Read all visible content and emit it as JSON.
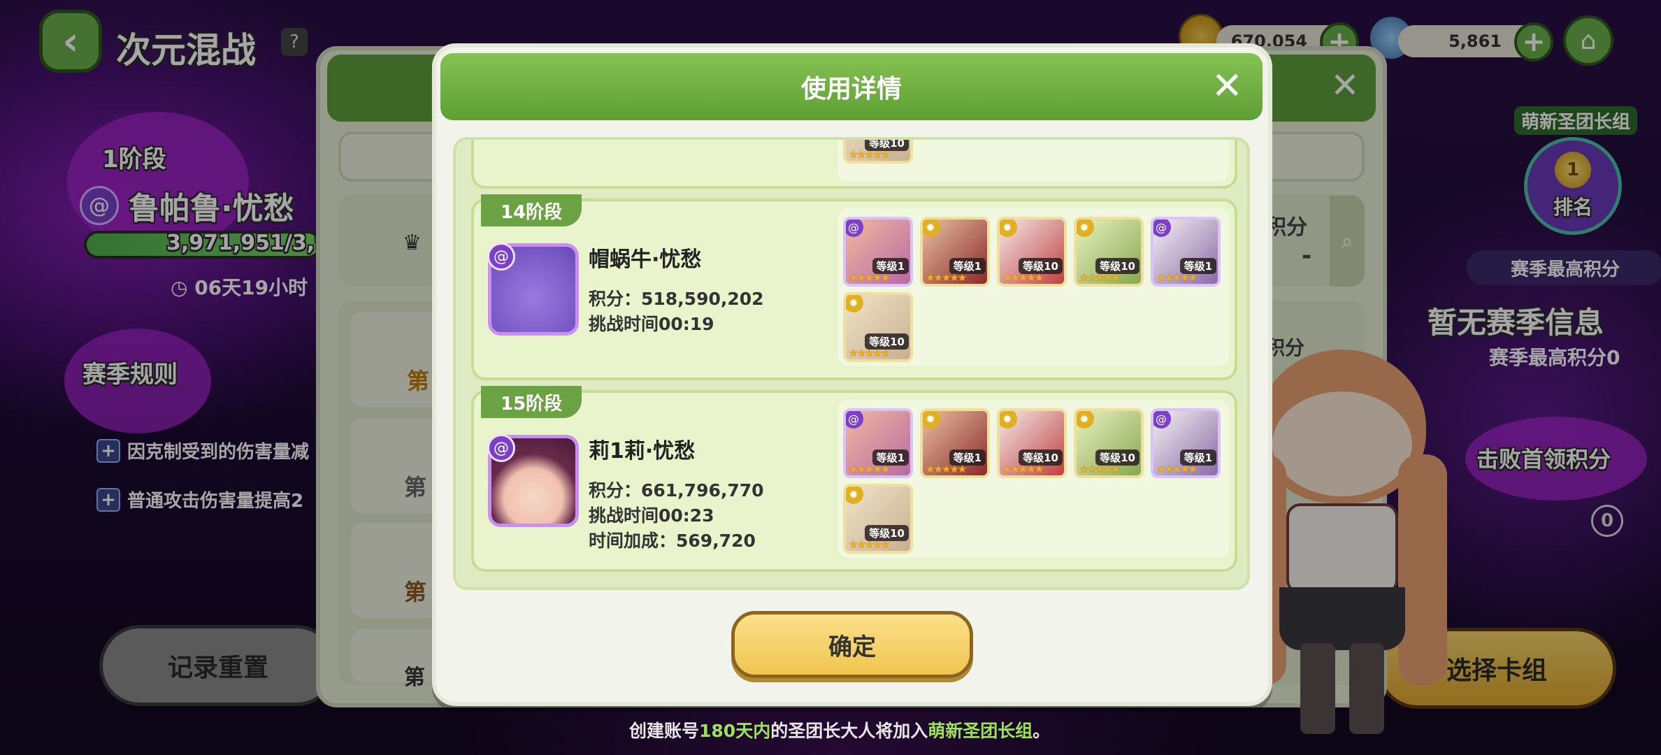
{
  "top_bar": {
    "title": "次元混战",
    "help_icon": "?",
    "gold_value": "670,054",
    "gem_value": "5,861"
  },
  "left_panel": {
    "stage": "1阶段",
    "boss_name": "鲁帕鲁·忧愁",
    "hp_text": "3,971,951/3,9",
    "timer": "06天19小时",
    "rules_title": "赛季规则",
    "buffs": [
      "因克制受到的伤害量减",
      "普通攻击伤害量提高2"
    ],
    "reset_button": "记录重置"
  },
  "right_panel": {
    "guild_tag": "萌新圣团长组",
    "rank_number": "1",
    "rank_label": "排名",
    "season_best_label": "赛季最高积分",
    "no_season_info": "暂无赛季信息",
    "season_best_value": "赛季最高积分0",
    "defeat_boss_label": "击败首领积分",
    "defeat_boss_value": "0",
    "select_deck_button": "选择卡组"
  },
  "under_panel": {
    "score_label": "积分",
    "score_value": "-",
    "score_label2": "积分",
    "rank_partial": [
      "第",
      "第",
      "第",
      "第"
    ]
  },
  "modal": {
    "title": "使用详情",
    "confirm_label": "确定",
    "partial_top_level": "等级10",
    "entries": [
      {
        "stage": "14阶段",
        "boss_name": "帽蜗牛·忧愁",
        "score": "积分：518,590,202",
        "time": "挑战时间00:19",
        "bonus": "",
        "heroes": [
          {
            "level": "等级1",
            "element": "purple"
          },
          {
            "level": "等级1",
            "element": "yellow"
          },
          {
            "level": "等级10",
            "element": "yellow"
          },
          {
            "level": "等级10",
            "element": "yellow"
          },
          {
            "level": "等级1",
            "element": "purple"
          },
          {
            "level": "等级10",
            "element": "yellow"
          }
        ]
      },
      {
        "stage": "15阶段",
        "boss_name": "莉1莉·忧愁",
        "score": "积分：661,796,770",
        "time": "挑战时间00:23",
        "bonus": "时间加成：569,720",
        "heroes": [
          {
            "level": "等级1",
            "element": "purple"
          },
          {
            "level": "等级1",
            "element": "yellow"
          },
          {
            "level": "等级10",
            "element": "yellow"
          },
          {
            "level": "等级10",
            "element": "yellow"
          },
          {
            "level": "等级1",
            "element": "purple"
          },
          {
            "level": "等级10",
            "element": "yellow"
          }
        ]
      }
    ]
  },
  "footer": {
    "part1": "创建账号",
    "highlight1": "180天内",
    "part2": "的圣团长大人将加入",
    "highlight2": "萌新圣团长组",
    "part3": "。"
  },
  "colors": {
    "accent_green": "#6ab04c",
    "confirm_yellow": "#f0c450",
    "purple_element": "#7b3fc9",
    "yellow_element": "#e0b020"
  }
}
